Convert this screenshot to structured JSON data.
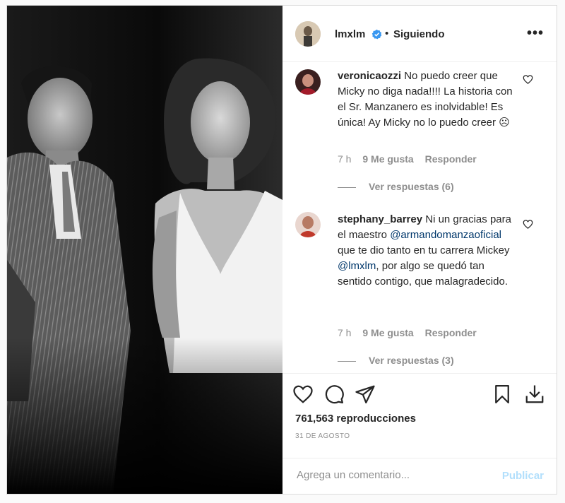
{
  "post": {
    "username": "lmxlm",
    "follow_status": "Siguiendo",
    "more_label": "•••",
    "dot": "•"
  },
  "comments": [
    {
      "username": "veronicaozzi",
      "text": "No puedo creer que Micky no diga nada!!!! La historia con el Sr. Manzanero es inolvidable! Es única! Ay Micky no lo puedo creer ☹",
      "time": "7 h",
      "likes": "9 Me gusta",
      "reply_label": "Responder",
      "view_replies": "Ver respuestas (6)"
    },
    {
      "username": "stephany_barrey",
      "text_1": "Ni un gracias para el maestro",
      "mention_1": "@armandomanzaoficial",
      "text_2": "que te dio tanto en tu carrera Mickey",
      "mention_2": "@lmxlm",
      "text_3": ", por algo se quedó tan sentido contigo, que malagradecido.",
      "time": "7 h",
      "likes": "9 Me gusta",
      "reply_label": "Responder",
      "view_replies": "Ver respuestas (3)"
    }
  ],
  "stats": {
    "views": "761,563 reproducciones",
    "date": "31 DE AGOSTO"
  },
  "composer": {
    "placeholder": "Agrega un comentario...",
    "publish": "Publicar"
  },
  "colors": {
    "verified": "#3897f0",
    "link": "#00376b",
    "publish_disabled": "#b2dffc"
  },
  "icons": [
    "verified-icon",
    "heart-icon",
    "comment-icon",
    "share-icon",
    "bookmark-icon",
    "download-icon"
  ]
}
